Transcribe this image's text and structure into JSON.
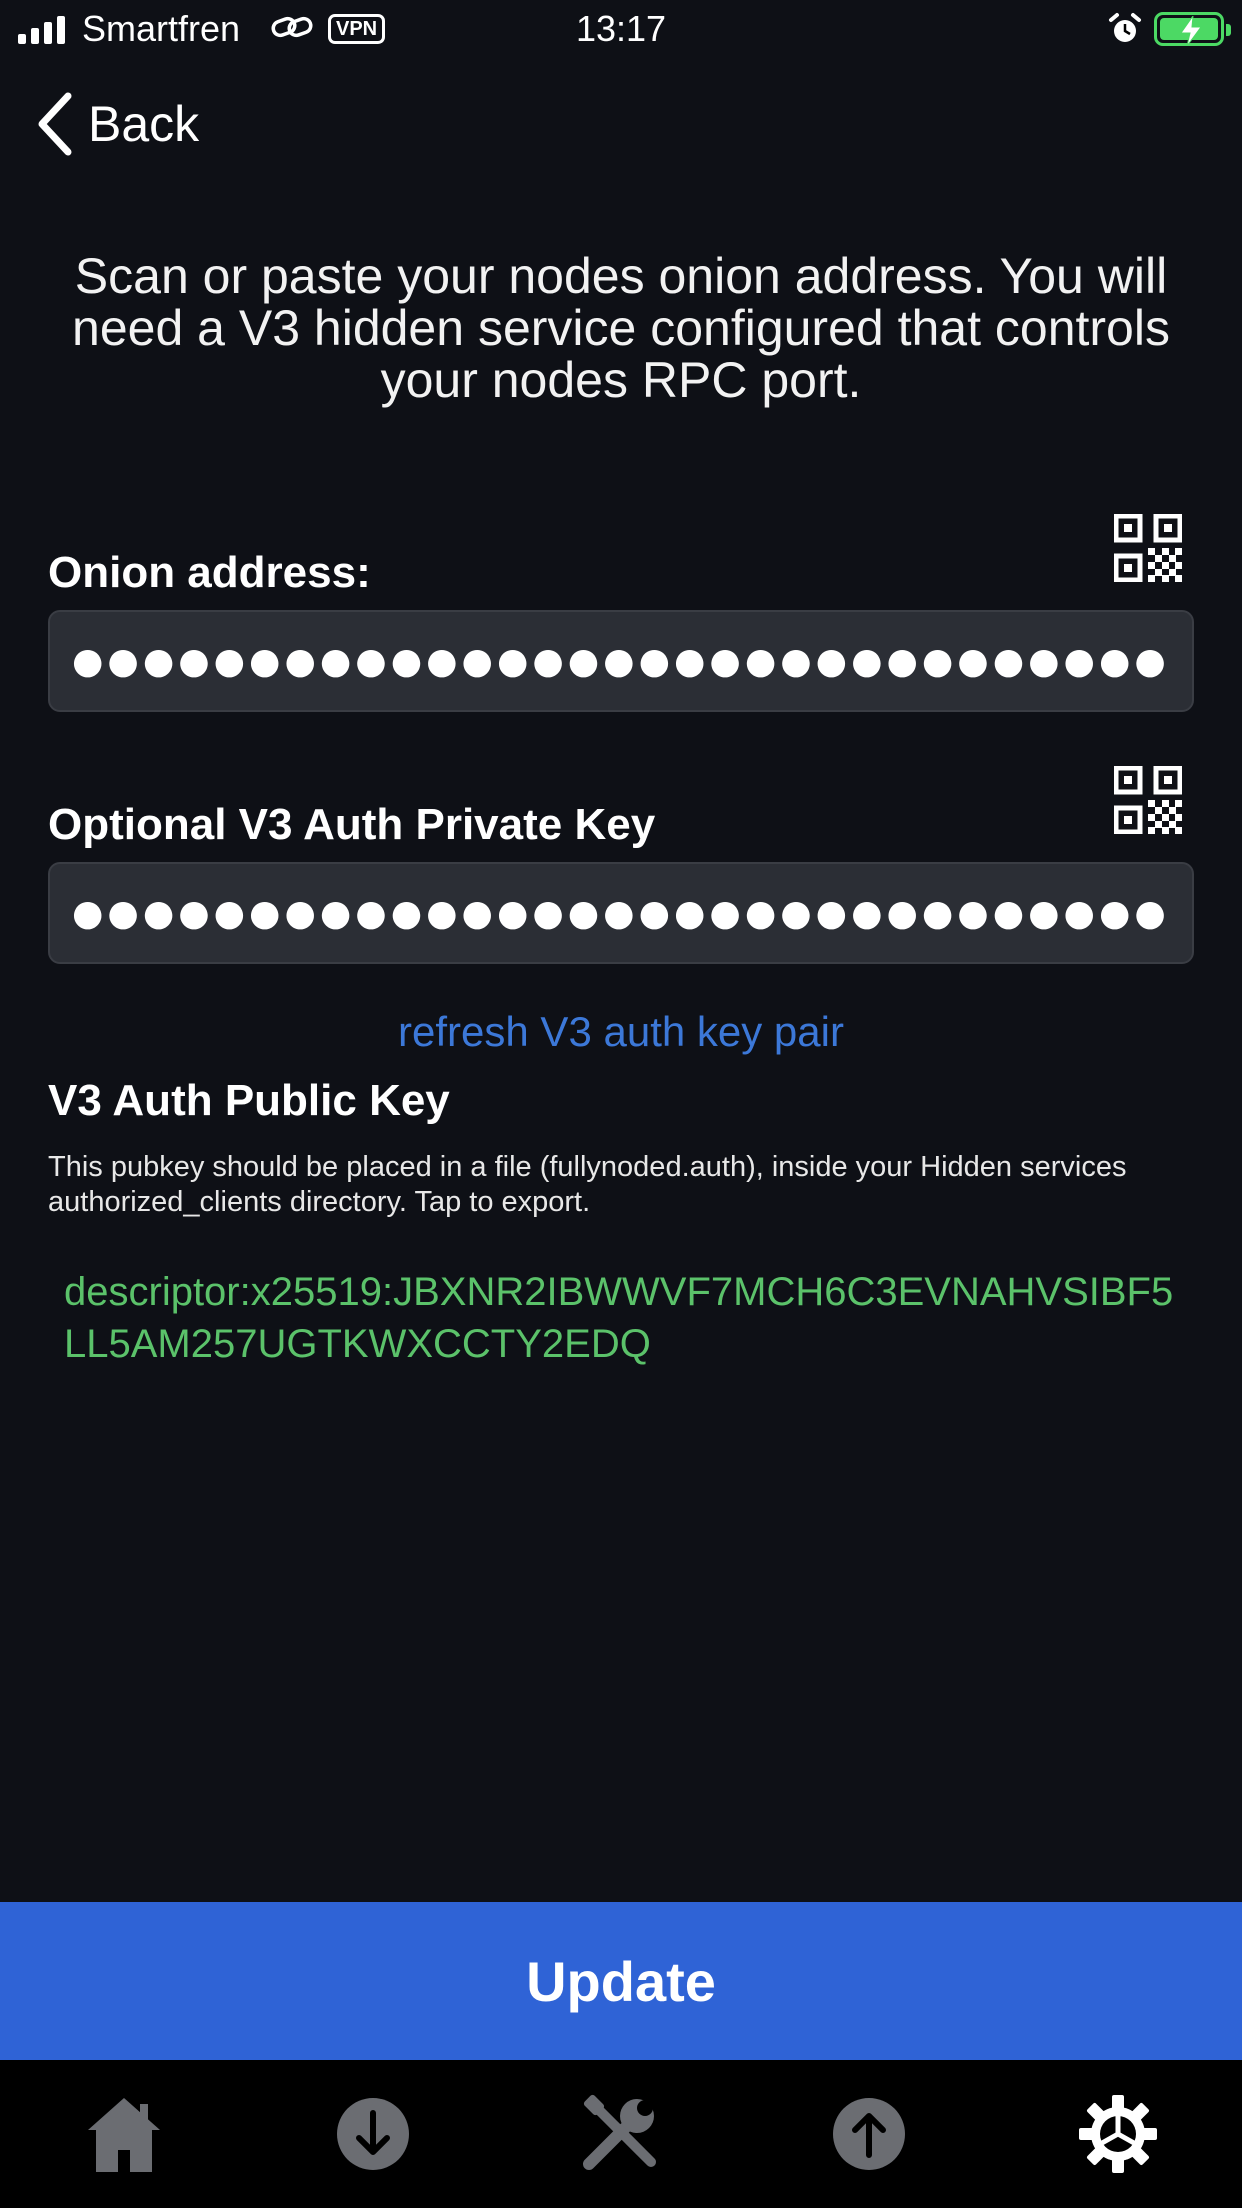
{
  "status_bar": {
    "carrier": "Smartfren",
    "vpn": "VPN",
    "time": "13:17"
  },
  "nav": {
    "back_label": "Back"
  },
  "instructions": "Scan or paste your nodes onion address. You will need a V3 hidden service configured that controls your nodes RPC port.",
  "onion": {
    "label": "Onion address:",
    "value": "●●●●●●●●●●●●●●●●●●●●●●●●●●●●●●●●●●●●●●●●●…"
  },
  "private_key": {
    "label": "Optional V3 Auth Private Key",
    "value": "●●●●●●●●●●●●●●●●●●●●●●●●●●●●●●●●●●●●●●●●●…"
  },
  "refresh_link": "refresh V3 auth key pair",
  "public_key": {
    "heading": "V3 Auth Public Key",
    "help": "This pubkey should be placed in a file (fullynoded.auth), inside your Hidden services authorized_clients directory. Tap to export.",
    "value": "descriptor:x25519:JBXNR2IBWWVF7MCH6C3EVNAHVSIBF5LL5AM257UGTKWXCCTY2EDQ"
  },
  "update_button": "Update",
  "tabs": [
    {
      "icon": "home-icon"
    },
    {
      "icon": "download-icon"
    },
    {
      "icon": "tools-icon"
    },
    {
      "icon": "upload-icon"
    },
    {
      "icon": "gear-icon"
    }
  ],
  "colors": {
    "accent_blue": "#2f63d6",
    "link_blue": "#3c78d8",
    "pubkey_green": "#5bc26a",
    "battery_green": "#4cd964"
  }
}
